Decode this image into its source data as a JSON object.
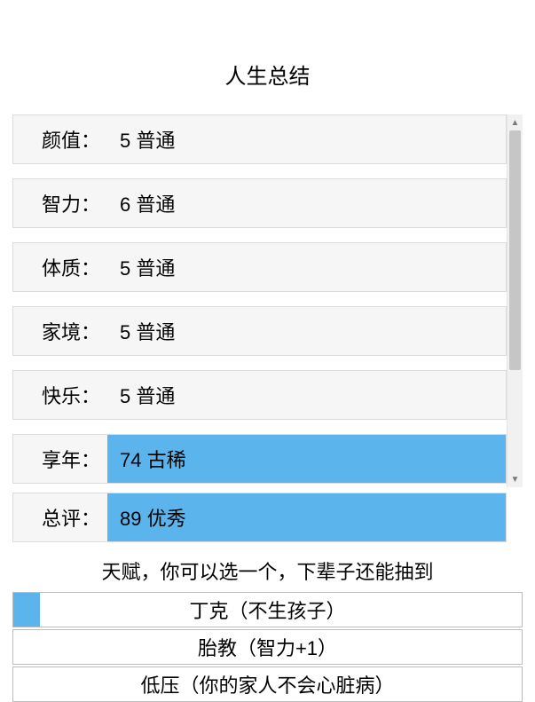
{
  "title": "人生总结",
  "stats": [
    {
      "label": "颜值：",
      "value": "5 普通",
      "highlight": false
    },
    {
      "label": "智力：",
      "value": "6 普通",
      "highlight": false
    },
    {
      "label": "体质：",
      "value": "5 普通",
      "highlight": false
    },
    {
      "label": "家境：",
      "value": "5 普通",
      "highlight": false
    },
    {
      "label": "快乐：",
      "value": "5 普通",
      "highlight": false
    },
    {
      "label": "享年：",
      "value": "74 古稀",
      "highlight": true
    },
    {
      "label": "总评：",
      "value": "89 优秀",
      "highlight": true
    }
  ],
  "talent_hint": "天赋，你可以选一个，下辈子还能抽到",
  "talents": [
    {
      "label": "丁克（不生孩子）",
      "selected": true
    },
    {
      "label": "胎教（智力+1）",
      "selected": false
    },
    {
      "label": "低压（你的家人不会心脏病）",
      "selected": false
    }
  ],
  "scroll": {
    "up": "▲",
    "down": "▼"
  }
}
